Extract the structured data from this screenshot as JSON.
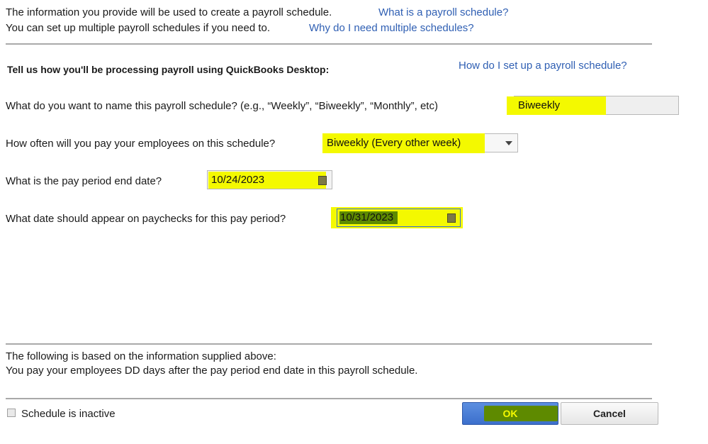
{
  "intro": {
    "line1": "The information you provide will be used to create a payroll schedule.",
    "line2": "You can set up multiple payroll schedules if you need to.",
    "link1": "What is a payroll schedule?",
    "link2": "Why do I need multiple schedules?"
  },
  "section": {
    "heading": "Tell us how you'll be processing payroll using QuickBooks Desktop:",
    "help_link": "How do I set up a payroll schedule?"
  },
  "questions": {
    "name": {
      "label": "What do you want to name this payroll schedule? (e.g., “Weekly”, “Biweekly”, “Monthly”, etc)",
      "value": "Biweekly"
    },
    "frequency": {
      "label": "How often will you pay your employees on this schedule?",
      "value": "Biweekly (Every other week)"
    },
    "end_date": {
      "label": "What is the pay period end date?",
      "value": "10/24/2023"
    },
    "paycheck_date": {
      "label": "What date should appear on paychecks for this pay period?",
      "value": "10/31/2023"
    }
  },
  "summary": {
    "line1": "The following is based on the information supplied above:",
    "line2": "You pay your employees DD days after the pay period end date in this payroll schedule."
  },
  "footer": {
    "inactive_label": "Schedule is inactive",
    "ok_label": "OK",
    "cancel_label": "Cancel"
  },
  "colors": {
    "link": "#2f5fb3",
    "highlight_yellow": "#f4f900",
    "highlight_green": "#5e8a00",
    "ok_button": "#4a7fd6"
  },
  "icons": [
    "dropdown-caret-icon",
    "calendar-icon",
    "checkbox-icon"
  ]
}
